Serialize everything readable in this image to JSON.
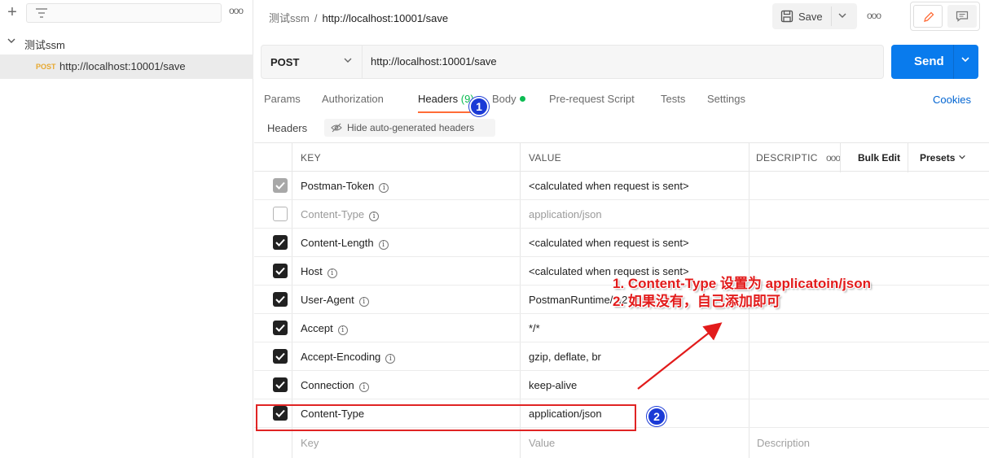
{
  "sidebar": {
    "plus_label": "+",
    "more_label": "ooo",
    "collection_name": "测试ssm",
    "request": {
      "method": "POST",
      "url": "http://localhost:10001/save"
    }
  },
  "header": {
    "breadcrumb_collection": "测试ssm",
    "breadcrumb_separator": "/",
    "breadcrumb_request": "http://localhost:10001/save",
    "save_label": "Save",
    "more_label": "ooo"
  },
  "request_bar": {
    "method": "POST",
    "url": "http://localhost:10001/save",
    "send_label": "Send"
  },
  "tabs": [
    {
      "label": "Params"
    },
    {
      "label": "Authorization"
    },
    {
      "label": "Headers",
      "count": "(9)"
    },
    {
      "label": "Body"
    },
    {
      "label": "Pre-request Script"
    },
    {
      "label": "Tests"
    },
    {
      "label": "Settings"
    }
  ],
  "cookies_label": "Cookies",
  "headers_sub": {
    "label": "Headers",
    "hide_label": "Hide auto-generated headers"
  },
  "table": {
    "col_key": "KEY",
    "col_value": "VALUE",
    "col_desc": "DESCRIPTIC",
    "more": "ooo",
    "bulk_edit": "Bulk Edit",
    "presets": "Presets",
    "info": "i",
    "rows": [
      {
        "key": "Postman-Token",
        "value": "<calculated when request is sent>",
        "state": "grey",
        "info": true
      },
      {
        "key": "Content-Type",
        "value": "application/json",
        "state": "off",
        "info": true
      },
      {
        "key": "Content-Length",
        "value": "<calculated when request is sent>",
        "state": "on",
        "info": true
      },
      {
        "key": "Host",
        "value": "<calculated when request is sent>",
        "state": "on",
        "info": true
      },
      {
        "key": "User-Agent",
        "value": "PostmanRuntime/7.2",
        "state": "on",
        "info": true
      },
      {
        "key": "Accept",
        "value": "*/*",
        "state": "on",
        "info": true
      },
      {
        "key": "Accept-Encoding",
        "value": "gzip, deflate, br",
        "state": "on",
        "info": true
      },
      {
        "key": "Connection",
        "value": "keep-alive",
        "state": "on",
        "info": true
      },
      {
        "key": "Content-Type",
        "value": "application/json",
        "state": "on",
        "info": false
      }
    ],
    "placeholder_key": "Key",
    "placeholder_value": "Value",
    "placeholder_desc": "Description"
  },
  "annotations": {
    "badge1": "1",
    "badge2": "2",
    "note_line1": "1. Content-Type 设置为 applicatoin/json",
    "note_line2": "2. 如果没有，自己添加即可",
    "color": "#e21b1b",
    "badge_color": "#1a3ad6"
  },
  "colors": {
    "send": "#097bed",
    "accent": "#ff6c37",
    "green": "#0cbb52",
    "link": "#0265d2"
  }
}
